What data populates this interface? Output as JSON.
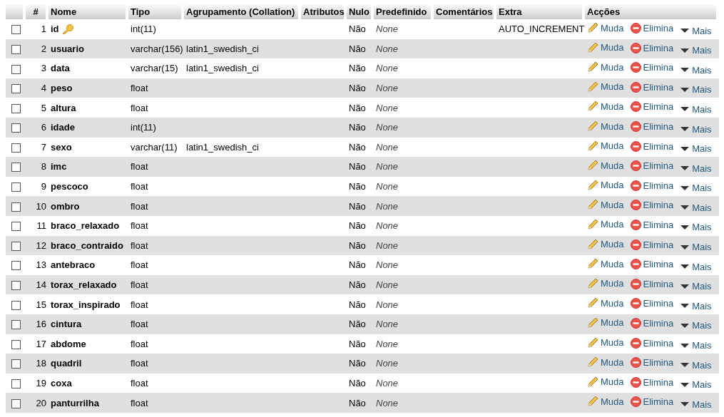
{
  "columns": [
    "#",
    "Nome",
    "Tipo",
    "Agrupamento (Collation)",
    "Atributos",
    "Nulo",
    "Predefinido",
    "Comentários",
    "Extra",
    "Acções"
  ],
  "rows": [
    {
      "checked": false,
      "num": "1",
      "name": "id",
      "primary_key": true,
      "type": "int(11)",
      "collation": "",
      "null": "Não",
      "default": "None",
      "extra": "AUTO_INCREMENT",
      "actions": [
        "Muda",
        "Elimina",
        "Mais"
      ]
    },
    {
      "checked": false,
      "num": "2",
      "name": "usuario",
      "primary_key": false,
      "type": "varchar(156)",
      "collation": "latin1_swedish_ci",
      "null": "Não",
      "default": "None",
      "extra": "",
      "actions": [
        "Muda",
        "Elimina",
        "Mais"
      ]
    },
    {
      "checked": false,
      "num": "3",
      "name": "data",
      "primary_key": false,
      "type": "varchar(15)",
      "collation": "latin1_swedish_ci",
      "null": "Não",
      "default": "None",
      "extra": "",
      "actions": [
        "Muda",
        "Elimina",
        "Mais"
      ]
    },
    {
      "checked": false,
      "num": "4",
      "name": "peso",
      "primary_key": false,
      "type": "float",
      "collation": "",
      "null": "Não",
      "default": "None",
      "extra": "",
      "actions": [
        "Muda",
        "Elimina",
        "Mais"
      ]
    },
    {
      "checked": false,
      "num": "5",
      "name": "altura",
      "primary_key": false,
      "type": "float",
      "collation": "",
      "null": "Não",
      "default": "None",
      "extra": "",
      "actions": [
        "Muda",
        "Elimina",
        "Mais"
      ]
    },
    {
      "checked": false,
      "num": "6",
      "name": "idade",
      "primary_key": false,
      "type": "int(11)",
      "collation": "",
      "null": "Não",
      "default": "None",
      "extra": "",
      "actions": [
        "Muda",
        "Elimina",
        "Mais"
      ]
    },
    {
      "checked": false,
      "num": "7",
      "name": "sexo",
      "primary_key": false,
      "type": "varchar(11)",
      "collation": "latin1_swedish_ci",
      "null": "Não",
      "default": "None",
      "extra": "",
      "actions": [
        "Muda",
        "Elimina",
        "Mais"
      ]
    },
    {
      "checked": false,
      "num": "8",
      "name": "imc",
      "primary_key": false,
      "type": "float",
      "collation": "",
      "null": "Não",
      "default": "None",
      "extra": "",
      "actions": [
        "Muda",
        "Elimina",
        "Mais"
      ]
    },
    {
      "checked": false,
      "num": "9",
      "name": "pescoco",
      "primary_key": false,
      "type": "float",
      "collation": "",
      "null": "Não",
      "default": "None",
      "extra": "",
      "actions": [
        "Muda",
        "Elimina",
        "Mais"
      ]
    },
    {
      "checked": false,
      "num": "10",
      "name": "ombro",
      "primary_key": false,
      "type": "float",
      "collation": "",
      "null": "Não",
      "default": "None",
      "extra": "",
      "actions": [
        "Muda",
        "Elimina",
        "Mais"
      ]
    },
    {
      "checked": false,
      "num": "11",
      "name": "braco_relaxado",
      "primary_key": false,
      "type": "float",
      "collation": "",
      "null": "Não",
      "default": "None",
      "extra": "",
      "actions": [
        "Muda",
        "Elimina",
        "Mais"
      ]
    },
    {
      "checked": false,
      "num": "12",
      "name": "braco_contraido",
      "primary_key": false,
      "type": "float",
      "collation": "",
      "null": "Não",
      "default": "None",
      "extra": "",
      "actions": [
        "Muda",
        "Elimina",
        "Mais"
      ]
    },
    {
      "checked": false,
      "num": "13",
      "name": "antebraco",
      "primary_key": false,
      "type": "float",
      "collation": "",
      "null": "Não",
      "default": "None",
      "extra": "",
      "actions": [
        "Muda",
        "Elimina",
        "Mais"
      ]
    },
    {
      "checked": false,
      "num": "14",
      "name": "torax_relaxado",
      "primary_key": false,
      "type": "float",
      "collation": "",
      "null": "Não",
      "default": "None",
      "extra": "",
      "actions": [
        "Muda",
        "Elimina",
        "Mais"
      ]
    },
    {
      "checked": false,
      "num": "15",
      "name": "torax_inspirado",
      "primary_key": false,
      "type": "float",
      "collation": "",
      "null": "Não",
      "default": "None",
      "extra": "",
      "actions": [
        "Muda",
        "Elimina",
        "Mais"
      ]
    },
    {
      "checked": false,
      "num": "16",
      "name": "cintura",
      "primary_key": false,
      "type": "float",
      "collation": "",
      "null": "Não",
      "default": "None",
      "extra": "",
      "actions": [
        "Muda",
        "Elimina",
        "Mais"
      ]
    },
    {
      "checked": false,
      "num": "17",
      "name": "abdome",
      "primary_key": false,
      "type": "float",
      "collation": "",
      "null": "Não",
      "default": "None",
      "extra": "",
      "actions": [
        "Muda",
        "Elimina",
        "Mais"
      ]
    },
    {
      "checked": false,
      "num": "18",
      "name": "quadril",
      "primary_key": false,
      "type": "float",
      "collation": "",
      "null": "Não",
      "default": "None",
      "extra": "",
      "actions": [
        "Muda",
        "Elimina",
        "Mais"
      ]
    },
    {
      "checked": false,
      "num": "19",
      "name": "coxa",
      "primary_key": false,
      "type": "float",
      "collation": "",
      "null": "Não",
      "default": "None",
      "extra": "",
      "actions": [
        "Muda",
        "Elimina",
        "Mais"
      ]
    },
    {
      "checked": false,
      "num": "20",
      "name": "panturrilha",
      "primary_key": false,
      "type": "float",
      "collation": "",
      "null": "Não",
      "default": "None",
      "extra": "",
      "actions": [
        "Muda",
        "Elimina",
        "Mais"
      ]
    }
  ]
}
